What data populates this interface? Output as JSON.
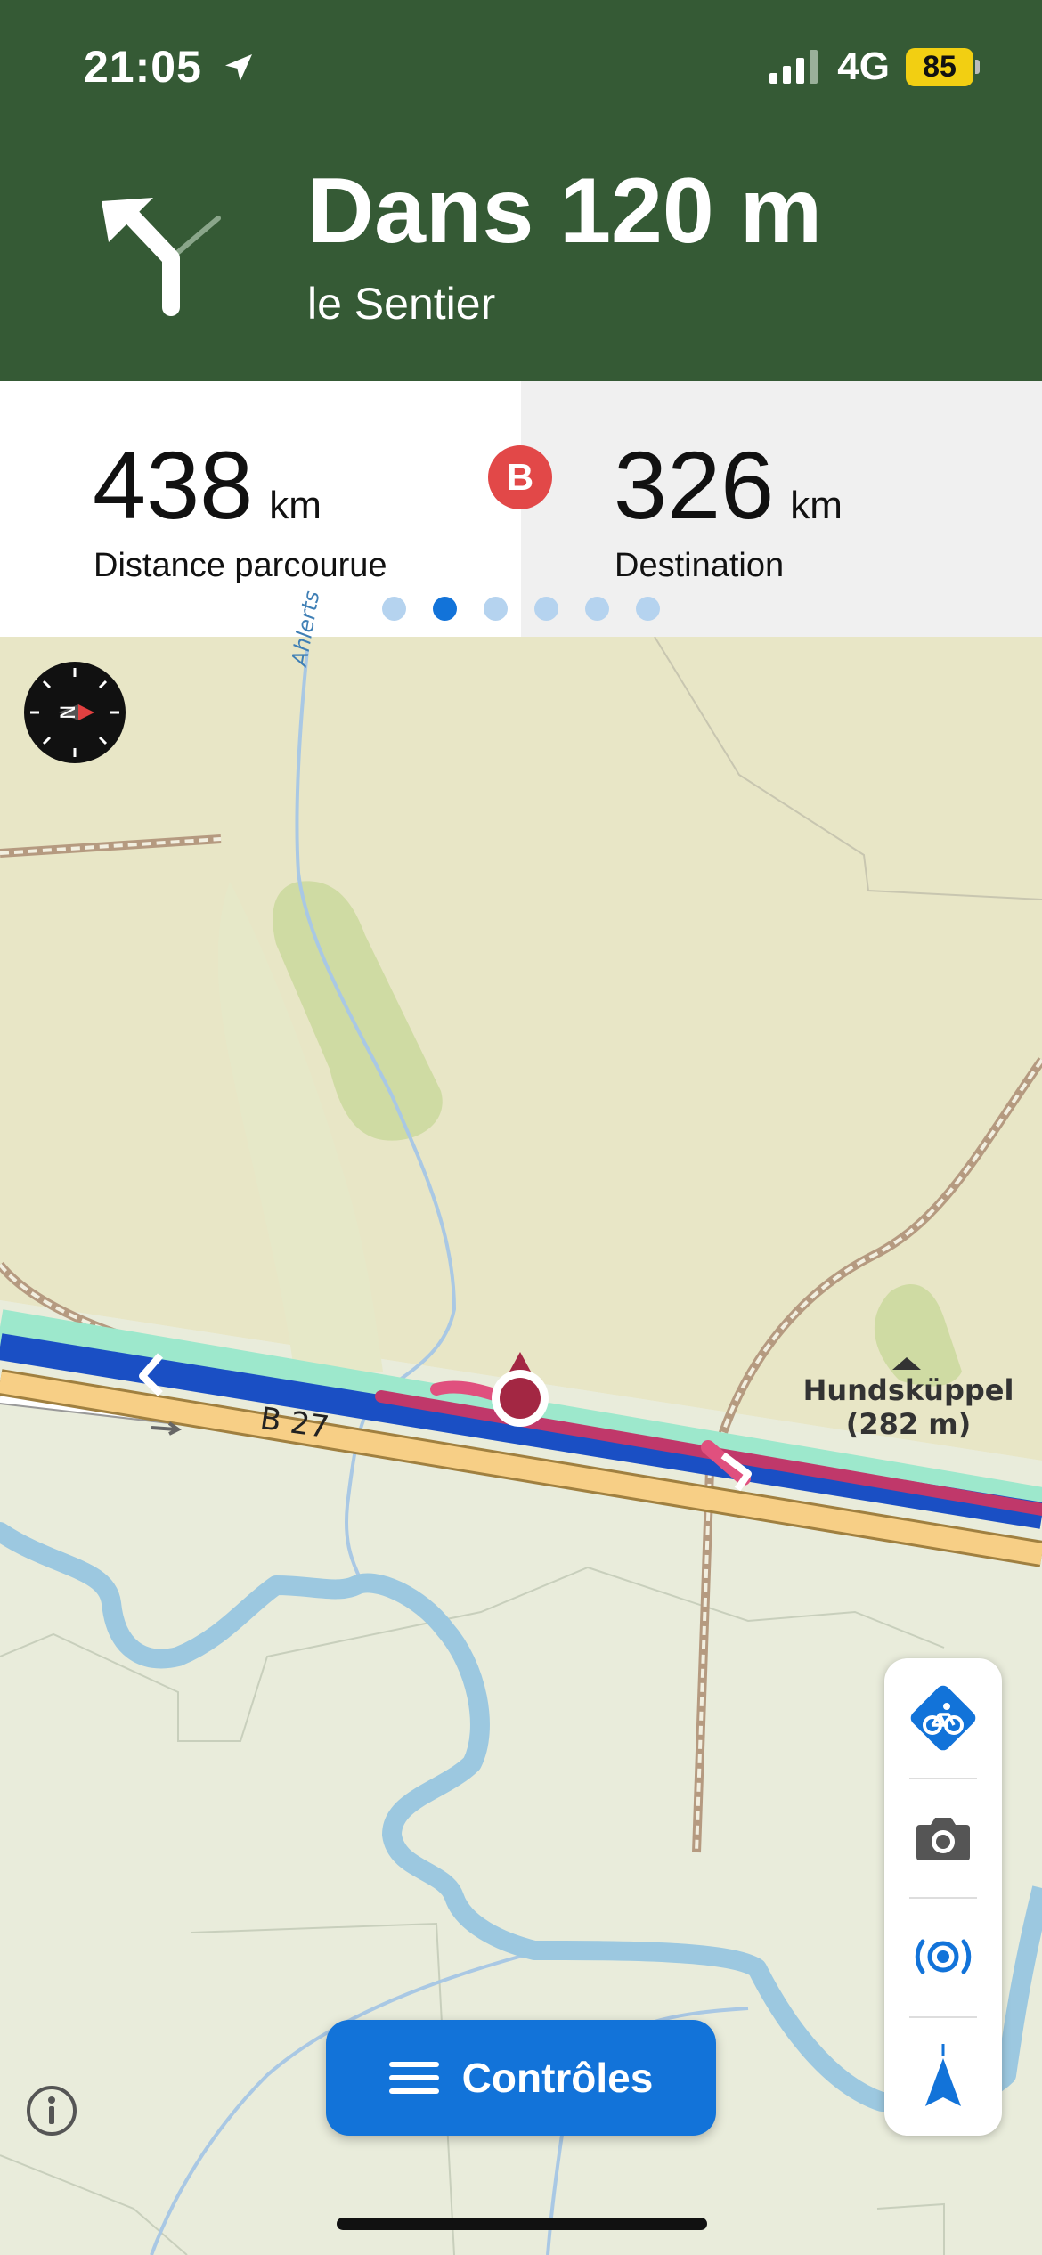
{
  "status_bar": {
    "time": "21:05",
    "location_icon": "location-arrow-icon",
    "signal_icon": "cell-signal-icon",
    "network": "4G",
    "battery": "85"
  },
  "instruction": {
    "turn_icon": "turn-slight-left-icon",
    "distance": "Dans 120 m",
    "street": "le Sentier"
  },
  "stats": {
    "traveled_value": "438",
    "traveled_unit": "km",
    "traveled_label": "Distance parcourue",
    "waypoint_badge": "B",
    "destination_value": "326",
    "destination_unit": "km",
    "destination_label": "Destination",
    "page_count": 6,
    "active_page": 2
  },
  "map": {
    "river_label": "Ahlerts",
    "road_label": "B 27",
    "poi_name": "Hundsküppel",
    "poi_elevation": "(282 m)",
    "compass_icon": "compass-icon",
    "colors": {
      "background": "#eceedd",
      "route": "#1a4fc4",
      "route_traveled": "#c0386a",
      "road_primary": "#f7cf86",
      "water": "#9cc8e0",
      "header": "#355a35",
      "accent": "#1273d9"
    }
  },
  "side_controls": [
    {
      "name": "bike-profile-button",
      "icon": "bicycle-icon"
    },
    {
      "name": "camera-button",
      "icon": "camera-icon"
    },
    {
      "name": "live-tracking-button",
      "icon": "broadcast-icon"
    },
    {
      "name": "recenter-button",
      "icon": "navigation-arrow-icon"
    }
  ],
  "controls_button": {
    "label": "Contrôles",
    "icon": "menu-icon"
  },
  "info_icon": "info-icon"
}
